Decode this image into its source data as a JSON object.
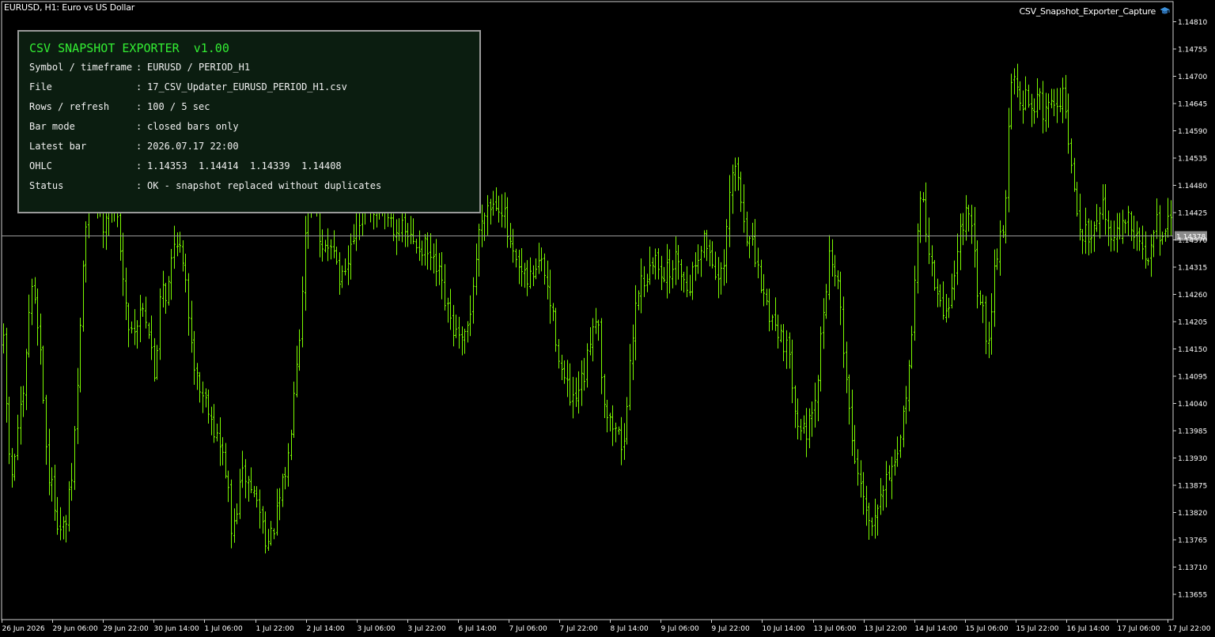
{
  "window": {
    "title": "EURUSD, H1:  Euro vs US Dollar",
    "expert_name": "CSV_Snapshot_Exporter_Capture",
    "expert_icon": "graduation-cap-icon"
  },
  "panel": {
    "title": "CSV SNAPSHOT EXPORTER  v1.00",
    "rows": [
      {
        "label": "Symbol / timeframe",
        "sep": ":",
        "value": "EURUSD / PERIOD_H1"
      },
      {
        "label": "File",
        "sep": ":",
        "value": "17_CSV_Updater_EURUSD_PERIOD_H1.csv"
      },
      {
        "label": "Rows / refresh",
        "sep": ":",
        "value": "100 / 5 sec"
      },
      {
        "label": "Bar mode",
        "sep": ":",
        "value": "closed bars only"
      },
      {
        "label": "Latest bar",
        "sep": ":",
        "value": "2026.07.17 22:00"
      },
      {
        "label": "OHLC",
        "sep": ":",
        "value": "1.14353  1.14414  1.14339  1.14408"
      },
      {
        "label": "Status",
        "sep": ":",
        "value": "OK - snapshot replaced without duplicates"
      }
    ]
  },
  "colors": {
    "background": "#000000",
    "bars": "#7CFC00",
    "panel_bg": "#0b1d10",
    "panel_title": "#33ee33",
    "price_line": "#9a9a9a",
    "axis_text": "#ffffff"
  },
  "chart_data": {
    "type": "ohlc",
    "symbol": "EURUSD",
    "timeframe": "H1",
    "y_ticks": [
      "1.14810",
      "1.14755",
      "1.14700",
      "1.14645",
      "1.14590",
      "1.14535",
      "1.14480",
      "1.14425",
      "1.14370",
      "1.14315",
      "1.14260",
      "1.14205",
      "1.14150",
      "1.14095",
      "1.14040",
      "1.13985",
      "1.13930",
      "1.13875",
      "1.13820",
      "1.13765",
      "1.13710",
      "1.13655"
    ],
    "x_ticks": [
      "26 Jun 2026",
      "29 Jun 06:00",
      "29 Jun 22:00",
      "30 Jun 14:00",
      "1 Jul 06:00",
      "1 Jul 22:00",
      "2 Jul 14:00",
      "3 Jul 06:00",
      "3 Jul 22:00",
      "6 Jul 14:00",
      "7 Jul 06:00",
      "7 Jul 22:00",
      "8 Jul 14:00",
      "9 Jul 06:00",
      "9 Jul 22:00",
      "10 Jul 14:00",
      "13 Jul 06:00",
      "13 Jul 22:00",
      "14 Jul 14:00",
      "15 Jul 06:00",
      "15 Jul 22:00",
      "16 Jul 14:00",
      "17 Jul 06:00",
      "17 Jul 22:00"
    ],
    "current_price": "1.14378",
    "ylim": [
      1.13635,
      1.14835
    ],
    "path": [
      [
        0,
        1.143
      ],
      [
        7,
        1.1405
      ],
      [
        14,
        1.1387
      ],
      [
        22,
        1.1399
      ],
      [
        30,
        1.1405
      ],
      [
        38,
        1.1427
      ],
      [
        45,
        1.1425
      ],
      [
        52,
        1.1412
      ],
      [
        60,
        1.139
      ],
      [
        68,
        1.1385
      ],
      [
        75,
        1.1378
      ],
      [
        82,
        1.1379
      ],
      [
        90,
        1.1388
      ],
      [
        98,
        1.1408
      ],
      [
        104,
        1.143
      ],
      [
        111,
        1.1444
      ],
      [
        117,
        1.1448
      ],
      [
        122,
        1.1447
      ],
      [
        129,
        1.144
      ],
      [
        137,
        1.1445
      ],
      [
        145,
        1.1442
      ],
      [
        150,
        1.144
      ],
      [
        158,
        1.1423
      ],
      [
        165,
        1.1419
      ],
      [
        173,
        1.142
      ],
      [
        180,
        1.1425
      ],
      [
        188,
        1.1418
      ],
      [
        196,
        1.1408
      ],
      [
        203,
        1.143
      ],
      [
        211,
        1.1425
      ],
      [
        218,
        1.1435
      ],
      [
        224,
        1.1438
      ],
      [
        232,
        1.143
      ],
      [
        240,
        1.142
      ],
      [
        247,
        1.141
      ],
      [
        255,
        1.1406
      ],
      [
        263,
        1.1404
      ],
      [
        270,
        1.1399
      ],
      [
        278,
        1.1395
      ],
      [
        286,
        1.139
      ],
      [
        293,
        1.1376
      ],
      [
        300,
        1.1384
      ],
      [
        307,
        1.139
      ],
      [
        314,
        1.1388
      ],
      [
        320,
        1.1386
      ],
      [
        327,
        1.1383
      ],
      [
        334,
        1.1378
      ],
      [
        340,
        1.1375
      ],
      [
        346,
        1.1379
      ],
      [
        352,
        1.1383
      ],
      [
        358,
        1.1388
      ],
      [
        365,
        1.1394
      ],
      [
        372,
        1.141
      ],
      [
        379,
        1.1419
      ],
      [
        385,
        1.1437
      ],
      [
        390,
        1.1446
      ],
      [
        397,
        1.1448
      ],
      [
        405,
        1.1433
      ],
      [
        412,
        1.1435
      ],
      [
        420,
        1.1438
      ],
      [
        428,
        1.1429
      ],
      [
        435,
        1.1428
      ],
      [
        443,
        1.1435
      ],
      [
        450,
        1.1441
      ],
      [
        458,
        1.1441
      ],
      [
        466,
        1.1445
      ],
      [
        474,
        1.1442
      ],
      [
        482,
        1.1445
      ],
      [
        490,
        1.1442
      ],
      [
        498,
        1.144
      ],
      [
        506,
        1.1439
      ],
      [
        514,
        1.1438
      ],
      [
        522,
        1.1436
      ],
      [
        530,
        1.1436
      ],
      [
        538,
        1.1435
      ],
      [
        546,
        1.1432
      ],
      [
        554,
        1.143
      ],
      [
        562,
        1.1424
      ],
      [
        570,
        1.142
      ],
      [
        578,
        1.1417
      ],
      [
        585,
        1.1415
      ],
      [
        592,
        1.142
      ],
      [
        598,
        1.1428
      ],
      [
        605,
        1.1438
      ],
      [
        612,
        1.1444
      ],
      [
        620,
        1.1444
      ],
      [
        628,
        1.1445
      ],
      [
        636,
        1.1443
      ],
      [
        643,
        1.1436
      ],
      [
        650,
        1.1432
      ],
      [
        658,
        1.143
      ],
      [
        665,
        1.1428
      ],
      [
        673,
        1.143
      ],
      [
        680,
        1.1433
      ],
      [
        688,
        1.143
      ],
      [
        695,
        1.1424
      ],
      [
        703,
        1.1417
      ],
      [
        710,
        1.141
      ],
      [
        718,
        1.1406
      ],
      [
        725,
        1.1403
      ],
      [
        733,
        1.1407
      ],
      [
        740,
        1.141
      ],
      [
        748,
        1.142
      ],
      [
        755,
        1.1423
      ],
      [
        762,
        1.1406
      ],
      [
        770,
        1.14
      ],
      [
        778,
        1.1399
      ],
      [
        785,
        1.1396
      ],
      [
        792,
        1.14
      ],
      [
        798,
        1.1416
      ],
      [
        805,
        1.1427
      ],
      [
        812,
        1.1429
      ],
      [
        820,
        1.143
      ],
      [
        828,
        1.1433
      ],
      [
        836,
        1.1431
      ],
      [
        844,
        1.143
      ],
      [
        851,
        1.1432
      ],
      [
        858,
        1.1434
      ],
      [
        866,
        1.1427
      ],
      [
        873,
        1.1429
      ],
      [
        880,
        1.1433
      ],
      [
        887,
        1.1437
      ],
      [
        894,
        1.1436
      ],
      [
        902,
        1.1432
      ],
      [
        909,
        1.1428
      ],
      [
        916,
        1.1432
      ],
      [
        923,
        1.1448
      ],
      [
        930,
        1.1452
      ],
      [
        937,
        1.1444
      ],
      [
        944,
        1.1438
      ],
      [
        951,
        1.1435
      ],
      [
        958,
        1.143
      ],
      [
        966,
        1.1425
      ],
      [
        973,
        1.1422
      ],
      [
        980,
        1.142
      ],
      [
        987,
        1.1418
      ],
      [
        994,
        1.1415
      ],
      [
        1000,
        1.141
      ],
      [
        1007,
        1.1402
      ],
      [
        1014,
        1.1398
      ],
      [
        1021,
        1.1399
      ],
      [
        1028,
        1.14
      ],
      [
        1035,
        1.1412
      ],
      [
        1042,
        1.1425
      ],
      [
        1049,
        1.1435
      ],
      [
        1056,
        1.143
      ],
      [
        1063,
        1.1422
      ],
      [
        1070,
        1.1408
      ],
      [
        1077,
        1.1396
      ],
      [
        1084,
        1.139
      ],
      [
        1091,
        1.1387
      ],
      [
        1098,
        1.138
      ],
      [
        1105,
        1.1382
      ],
      [
        1112,
        1.1387
      ],
      [
        1119,
        1.1388
      ],
      [
        1126,
        1.1392
      ],
      [
        1133,
        1.139
      ],
      [
        1140,
        1.1398
      ],
      [
        1147,
        1.141
      ],
      [
        1154,
        1.142
      ],
      [
        1160,
        1.144
      ],
      [
        1166,
        1.1448
      ],
      [
        1172,
        1.1436
      ],
      [
        1179,
        1.143
      ],
      [
        1186,
        1.1424
      ],
      [
        1193,
        1.1422
      ],
      [
        1200,
        1.1425
      ],
      [
        1207,
        1.143
      ],
      [
        1214,
        1.144
      ],
      [
        1221,
        1.1442
      ],
      [
        1228,
        1.1438
      ],
      [
        1235,
        1.1428
      ],
      [
        1242,
        1.1422
      ],
      [
        1249,
        1.1416
      ],
      [
        1256,
        1.143
      ],
      [
        1263,
        1.1438
      ],
      [
        1270,
        1.144
      ],
      [
        1276,
        1.1466
      ],
      [
        1283,
        1.147
      ],
      [
        1290,
        1.1462
      ],
      [
        1297,
        1.1466
      ],
      [
        1304,
        1.1464
      ],
      [
        1311,
        1.1466
      ],
      [
        1318,
        1.1463
      ],
      [
        1325,
        1.1465
      ],
      [
        1332,
        1.1464
      ],
      [
        1339,
        1.1466
      ],
      [
        1346,
        1.1465
      ],
      [
        1352,
        1.1453
      ],
      [
        1358,
        1.1446
      ],
      [
        1364,
        1.1439
      ],
      [
        1371,
        1.1438
      ],
      [
        1378,
        1.1439
      ],
      [
        1385,
        1.1441
      ],
      [
        1392,
        1.1445
      ],
      [
        1399,
        1.144
      ],
      [
        1406,
        1.1439
      ],
      [
        1413,
        1.1437
      ],
      [
        1420,
        1.1442
      ],
      [
        1427,
        1.144
      ],
      [
        1434,
        1.1438
      ],
      [
        1441,
        1.1436
      ],
      [
        1448,
        1.1432
      ],
      [
        1455,
        1.1438
      ],
      [
        1462,
        1.1442
      ],
      [
        1469,
        1.1436
      ],
      [
        1476,
        1.144
      ],
      [
        1480,
        1.14408
      ]
    ]
  }
}
